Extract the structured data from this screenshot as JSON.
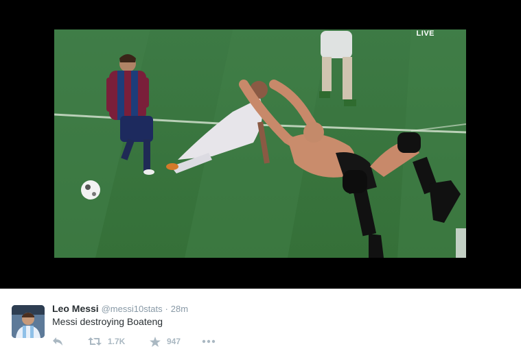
{
  "media": {
    "live_badge": "LIVE"
  },
  "tweet": {
    "author_name": "Leo Messi",
    "author_handle": "@messi10stats",
    "separator": "·",
    "timestamp": "28m",
    "text": "Messi destroying Boateng",
    "retweet_count": "1.7K",
    "favorite_count": "947"
  },
  "icons": {
    "reply": "reply-icon",
    "retweet": "retweet-icon",
    "favorite": "star-icon",
    "more": "more-dots-icon"
  },
  "colors": {
    "action_gray": "#aab8c2",
    "meta_gray": "#8899a6",
    "text_dark": "#292f33"
  }
}
